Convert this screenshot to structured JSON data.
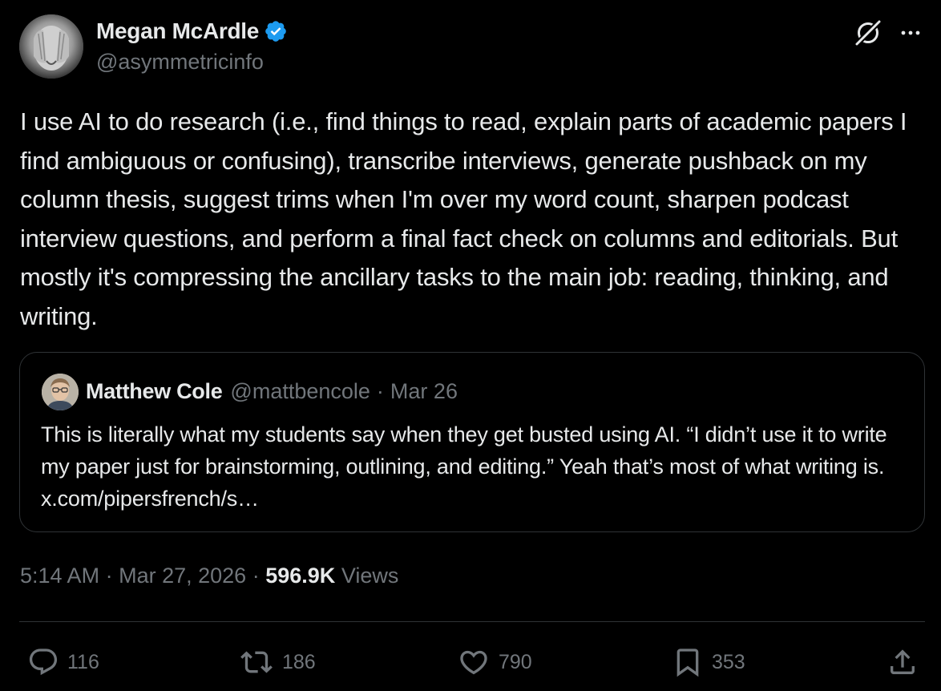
{
  "author": {
    "name": "Megan McArdle",
    "handle": "@asymmetricinfo",
    "verified": true
  },
  "icons": {
    "verified": "verified-badge-icon",
    "grok": "grok-icon",
    "more": "more-options-icon",
    "reply": "reply-icon",
    "retweet": "retweet-icon",
    "like": "like-icon",
    "bookmark": "bookmark-icon",
    "share": "share-icon"
  },
  "tweet": {
    "text": "I use AI to do research (i.e., find things to read, explain parts of academic papers I find ambiguous or confusing), transcribe interviews, generate pushback on my column thesis, suggest trims when I'm over my word count, sharpen podcast interview questions, and perform a final fact check on columns and editorials. But mostly it's compressing the ancillary tasks to the main job: reading, thinking, and writing."
  },
  "quote": {
    "name": "Matthew Cole",
    "handle": "@mattbencole",
    "separator": "·",
    "date": "Mar 26",
    "text": "This is literally what my students say when they get busted using AI. “I didn’t use it to write my paper just for brainstorming, outlining, and editing.” Yeah that’s most of what writing is. x.com/pipersfrench/s…"
  },
  "meta": {
    "time": "5:14 AM",
    "separator": "·",
    "date": "Mar 27, 2026",
    "views_count": "596.9K",
    "views_label": "Views"
  },
  "actions": {
    "replies": "116",
    "retweets": "186",
    "likes": "790",
    "bookmarks": "353"
  },
  "colors": {
    "background": "#000000",
    "text_primary": "#e7e9ea",
    "text_secondary": "#71767b",
    "border": "#2f3336",
    "verified_blue": "#1d9bf0"
  }
}
